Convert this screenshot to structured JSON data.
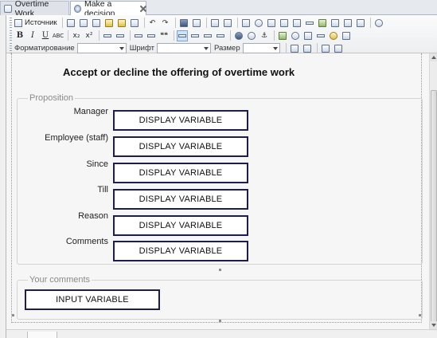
{
  "tabs": [
    {
      "label": "Overtime Work",
      "icon": "document-icon",
      "active": false
    },
    {
      "label": "Make a decision",
      "icon": "form-icon",
      "active": true
    }
  ],
  "toolbar": {
    "source_label": "Источник",
    "format_label": "Форматирование",
    "font_label": "Шрифт",
    "size_label": "Размер",
    "format_value": "",
    "font_value": "",
    "size_value": "",
    "bold_glyph": "B",
    "italic_glyph": "I",
    "underline_glyph": "U",
    "strike_glyph": "ABC",
    "subscript_glyph": "x₂",
    "superscript_glyph": "x²",
    "quote_glyph": "❝❝"
  },
  "form": {
    "heading": "Accept or decline the offering of overtime work",
    "proposition": {
      "legend": "Proposition",
      "fields": [
        {
          "label": "Manager",
          "value": "DISPLAY VARIABLE"
        },
        {
          "label": "Employee (staff)",
          "value": "DISPLAY VARIABLE"
        },
        {
          "label": "Since",
          "value": "DISPLAY VARIABLE"
        },
        {
          "label": "Till",
          "value": "DISPLAY VARIABLE"
        },
        {
          "label": "Reason",
          "value": "DISPLAY VARIABLE"
        },
        {
          "label": "Comments",
          "value": "DISPLAY VARIABLE"
        }
      ]
    },
    "comments": {
      "legend": "Your comments",
      "input": "INPUT VARIABLE"
    }
  },
  "colors": {
    "field_border": "#1e1e4a",
    "active_tab": "#ffffff",
    "toolbar_active": "#cde2fb"
  }
}
